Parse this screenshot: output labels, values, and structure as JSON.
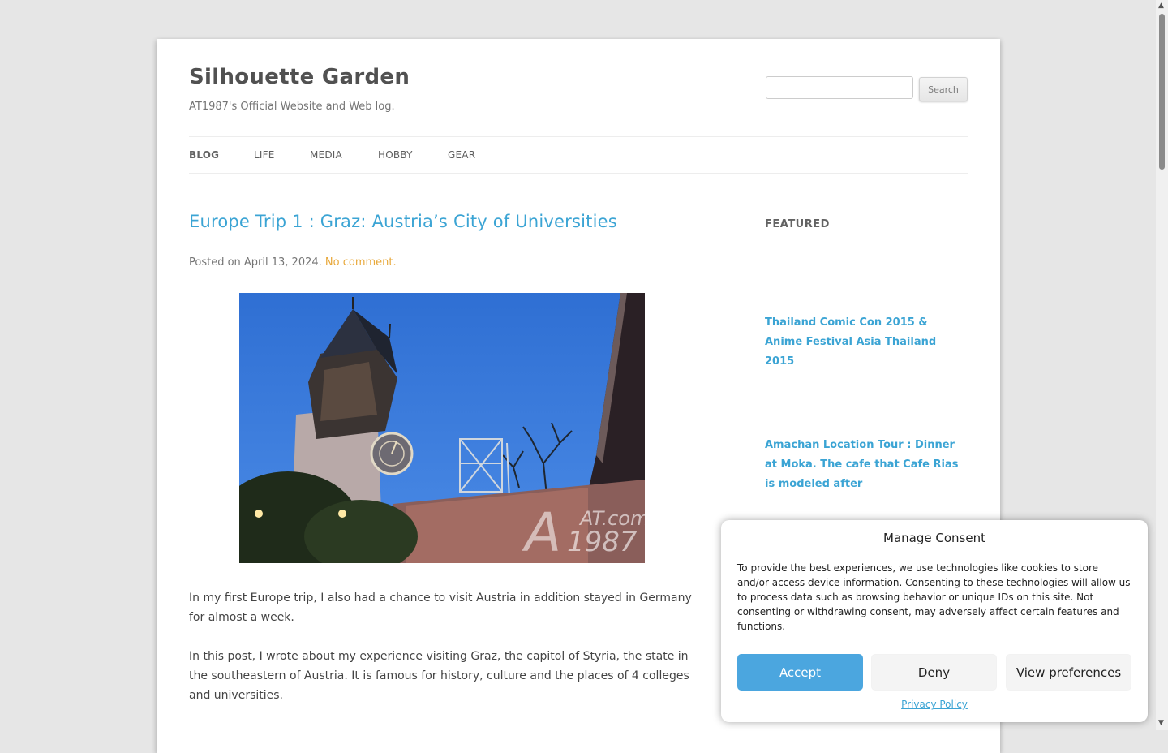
{
  "site": {
    "title": "Silhouette Garden",
    "description": "AT1987's Official Website and Web log."
  },
  "search": {
    "button_label": "Search",
    "value": ""
  },
  "nav": {
    "items": [
      "BLOG",
      "LIFE",
      "MEDIA",
      "HOBBY",
      "GEAR"
    ],
    "active": "BLOG"
  },
  "post": {
    "title": "Europe Trip 1 : Graz: Austria’s City of Universities",
    "meta_prefix": "Posted on April 13, 2024.",
    "comments_link": "No comment.",
    "image_watermark": {
      "top": "AT.com",
      "bottom": "1987"
    },
    "paragraphs": [
      "In my first Europe trip, I also had a chance to visit Austria in addition stayed in Germany for almost a week.",
      "In this post, I wrote about my experience visiting Graz, the capitol of Styria, the state in the southeastern of Austria. It is famous for history, culture and the places of 4 colleges and universities."
    ]
  },
  "sidebar": {
    "featured_title": "FEATURED",
    "featured_items": [
      "Thailand Comic Con 2015 & Anime Festival Asia Thailand 2015",
      "Amachan Location Tour : Dinner at Moka. The cafe that Cafe Rias is modeled after"
    ]
  },
  "consent": {
    "title": "Manage Consent",
    "text": "To provide the best experiences, we use technologies like cookies to store and/or access device information. Consenting to these technologies will allow us to process data such as browsing behavior or unique IDs on this site. Not consenting or withdrawing consent, may adversely affect certain features and functions.",
    "accept_label": "Accept",
    "deny_label": "Deny",
    "preferences_label": "View preferences",
    "privacy_link": "Privacy Policy"
  },
  "colors": {
    "link": "#3ba4d4",
    "comment_link": "#e8a93c",
    "accept_button": "#4ba6df",
    "background": "#e6e6e6"
  },
  "icons": {
    "scroll_up": "triangle-up-icon",
    "scroll_down": "triangle-down-icon"
  }
}
